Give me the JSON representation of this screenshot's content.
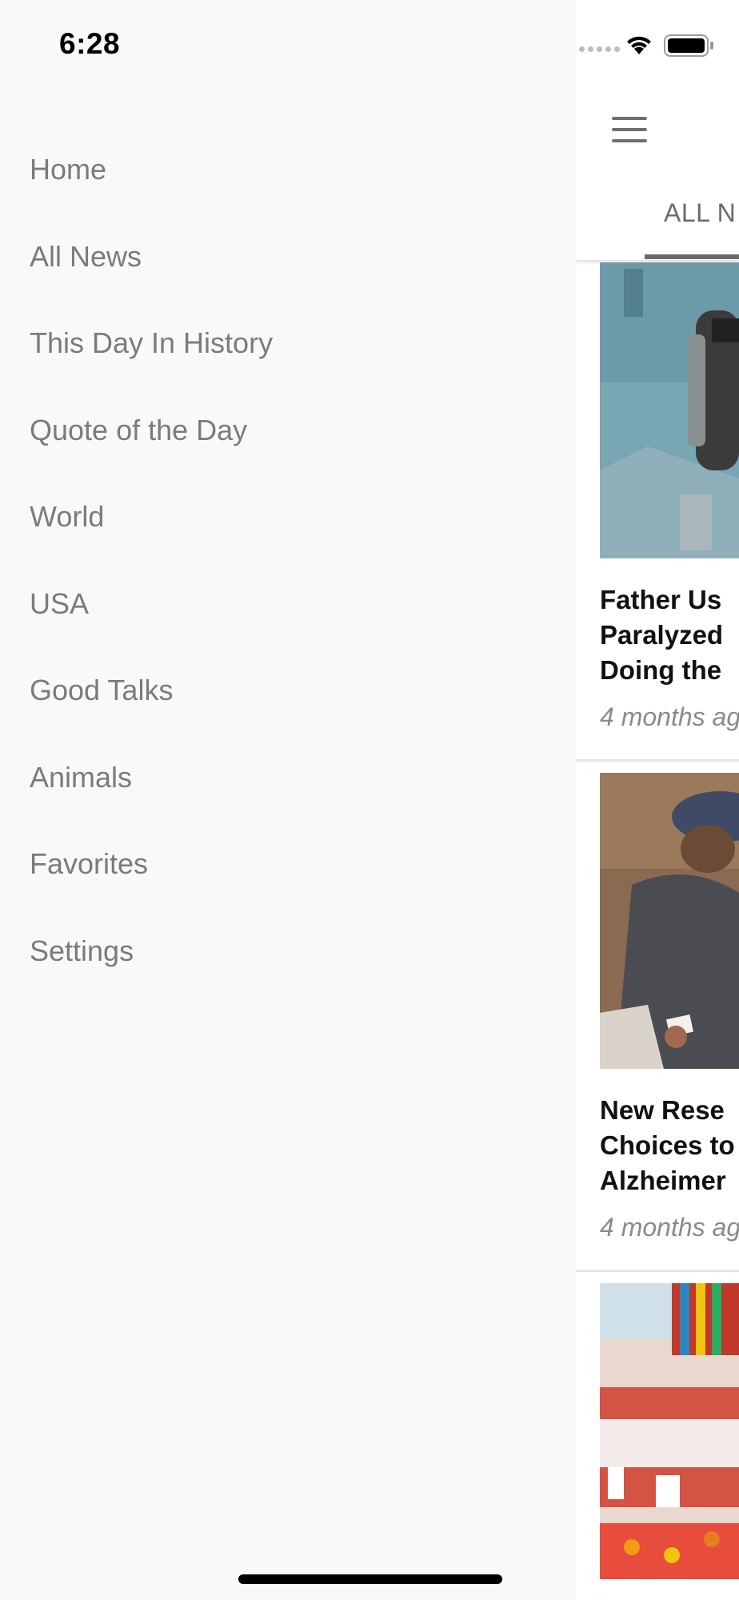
{
  "status_bar": {
    "time": "6:28"
  },
  "drawer": {
    "items": [
      {
        "label": "Home"
      },
      {
        "label": "All News"
      },
      {
        "label": "This Day In History"
      },
      {
        "label": "Quote of the Day"
      },
      {
        "label": "World"
      },
      {
        "label": "USA"
      },
      {
        "label": "Good Talks"
      },
      {
        "label": "Animals"
      },
      {
        "label": "Favorites"
      },
      {
        "label": "Settings"
      }
    ]
  },
  "header": {
    "active_tab": "ALL N"
  },
  "feed": [
    {
      "title": "Father Us\nParalyzed\nDoing the",
      "time": "4 months ag",
      "image": "scuba-diver-photo"
    },
    {
      "title": "New Rese\nChoices to\nAlzheimer",
      "time": "4 months ag",
      "image": "elderly-man-cards-photo"
    },
    {
      "image": "lego-exhibit-photo"
    }
  ],
  "colors": {
    "drawer_bg": "#f9f9f9",
    "menu_text": "#7b7b7b",
    "tab_text": "#6b6b6b"
  }
}
